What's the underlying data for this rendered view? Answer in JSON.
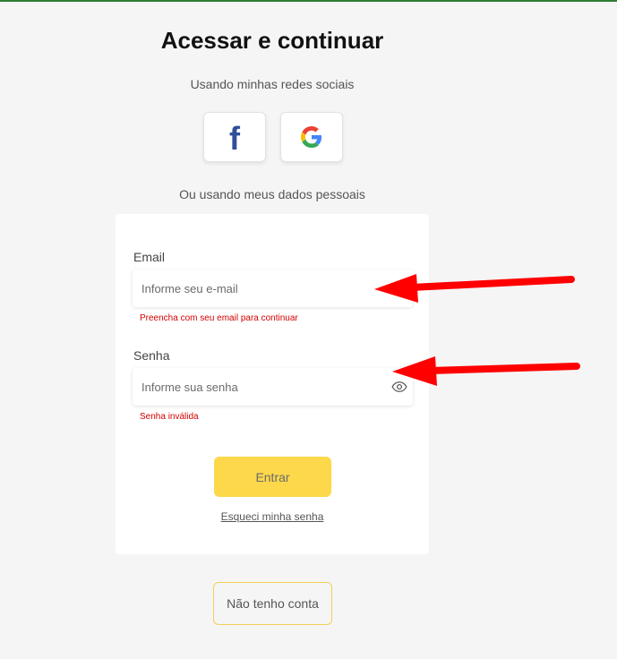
{
  "heading": "Acessar e continuar",
  "social": {
    "prompt": "Usando minhas redes sociais",
    "facebook_glyph": "f",
    "facebook_icon": "facebook-icon",
    "google_icon": "google-icon"
  },
  "personal_prompt": "Ou usando meus dados pessoais",
  "form": {
    "email": {
      "label": "Email",
      "placeholder": "Informe seu e-mail",
      "value": "",
      "error": "Preencha com seu email para continuar"
    },
    "password": {
      "label": "Senha",
      "placeholder": "Informe sua senha",
      "value": "",
      "error": "Senha inválida",
      "toggle_icon": "eye-icon"
    },
    "submit_label": "Entrar",
    "forgot_link": "Esqueci minha senha"
  },
  "no_account_label": "Não tenho conta",
  "colors": {
    "accent": "#fdd84a",
    "error": "#d50000",
    "annotation_arrow": "#ff0000",
    "top_bar": "#2e7d32"
  }
}
